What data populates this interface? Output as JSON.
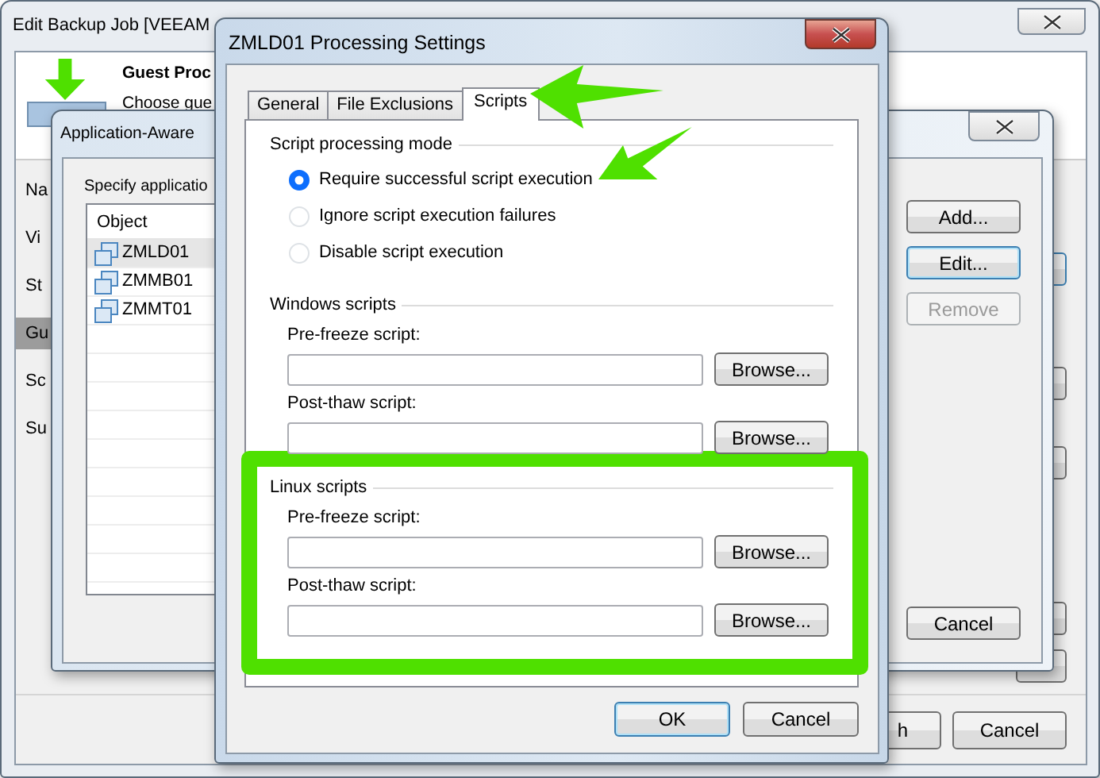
{
  "background_window": {
    "title": "Edit Backup Job [VEEAM",
    "header_title": "Guest Proc",
    "header_subtitle": "Choose gue",
    "nav": [
      {
        "label": "Na",
        "selected": false
      },
      {
        "label": "Vi",
        "selected": false
      },
      {
        "label": "St",
        "selected": false
      },
      {
        "label": "Gu",
        "selected": true
      },
      {
        "label": "Sc",
        "selected": false
      },
      {
        "label": "Su",
        "selected": false
      }
    ],
    "buttons": [
      "h",
      "Cancel"
    ]
  },
  "app_window": {
    "title": "Application-Aware",
    "instruction": "Specify applicatio",
    "list": {
      "column": "Object",
      "rows": [
        {
          "label": "ZMLD01",
          "selected": true
        },
        {
          "label": "ZMMB01",
          "selected": false
        },
        {
          "label": "ZMMT01",
          "selected": false
        }
      ]
    },
    "buttons": [
      {
        "label": "Add...",
        "kind": "normal"
      },
      {
        "label": "Edit...",
        "kind": "focused"
      },
      {
        "label": "Remove",
        "kind": "disabled"
      },
      {
        "label": "Cancel",
        "kind": "bottom"
      }
    ]
  },
  "dialog": {
    "title": "ZMLD01 Processing Settings",
    "tabs": [
      {
        "label": "General",
        "selected": false
      },
      {
        "label": "File Exclusions",
        "selected": false
      },
      {
        "label": "Scripts",
        "selected": true
      }
    ],
    "mode_group": {
      "title": "Script processing mode",
      "options": [
        {
          "label": "Require successful script execution",
          "selected": true
        },
        {
          "label": "Ignore script execution failures",
          "selected": false
        },
        {
          "label": "Disable script execution",
          "selected": false
        }
      ]
    },
    "groups": [
      {
        "title": "Windows scripts",
        "highlighted": false,
        "fields": [
          {
            "label": "Pre-freeze script:",
            "button": "Browse..."
          },
          {
            "label": "Post-thaw script:",
            "button": "Browse..."
          }
        ]
      },
      {
        "title": "Linux scripts",
        "highlighted": true,
        "fields": [
          {
            "label": "Pre-freeze script:",
            "button": "Browse..."
          },
          {
            "label": "Post-thaw script:",
            "button": "Browse..."
          }
        ]
      }
    ],
    "buttons": [
      {
        "label": "OK",
        "kind": "default"
      },
      {
        "label": "Cancel",
        "kind": "normal"
      }
    ]
  }
}
